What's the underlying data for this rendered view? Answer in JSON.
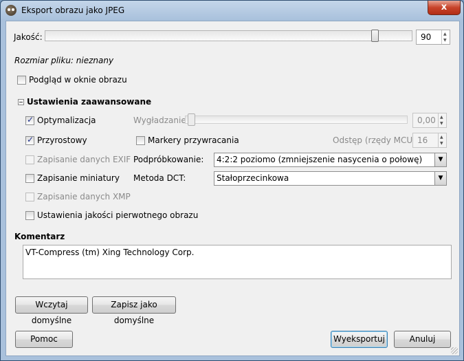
{
  "window": {
    "title": "Eksport obrazu jako JPEG",
    "close_label": "x"
  },
  "quality": {
    "label": "Jakość:",
    "value": "90",
    "level_percent": 90
  },
  "file_size": "Rozmiar pliku: nieznany",
  "preview": {
    "label": "Podgląd w oknie obrazu",
    "checked": false
  },
  "advanced": {
    "header": "Ustawienia zaawansowane",
    "optimize": {
      "label": "Optymalizacja",
      "checked": true
    },
    "progressive": {
      "label": "Przyrostowy",
      "checked": true
    },
    "save_exif": {
      "label": "Zapisanie danych EXIF",
      "checked": false,
      "enabled": false
    },
    "save_thumbnail": {
      "label": "Zapisanie miniatury",
      "checked": false
    },
    "save_xmp": {
      "label": "Zapisanie danych XMP",
      "checked": false,
      "enabled": false
    },
    "original_quality": {
      "label": "Ustawienia jakości pierwotnego obrazu",
      "checked": false
    },
    "smoothing": {
      "label": "Wygładzanie:",
      "value": "0,00",
      "level_percent": 0
    },
    "restart_markers": {
      "label": "Markery przywracania",
      "checked": false
    },
    "interval": {
      "label": "Odstęp (rzędy MCU):",
      "value": "16"
    },
    "subsampling": {
      "label": "Podpróbkowanie:",
      "value": "4:2:2 poziomo (zmniejszenie nasycenia o połowę)"
    },
    "dct": {
      "label": "Metoda DCT:",
      "value": "Stałoprzecinkowa"
    }
  },
  "comment": {
    "label": "Komentarz",
    "value": "VT-Compress (tm) Xing Technology Corp."
  },
  "buttons": {
    "load_defaults": "Wczytaj domyślne",
    "save_defaults": "Zapisz jako domyślne",
    "help": "Pomoc",
    "export": "Wyeksportuj",
    "cancel": "Anuluj"
  }
}
